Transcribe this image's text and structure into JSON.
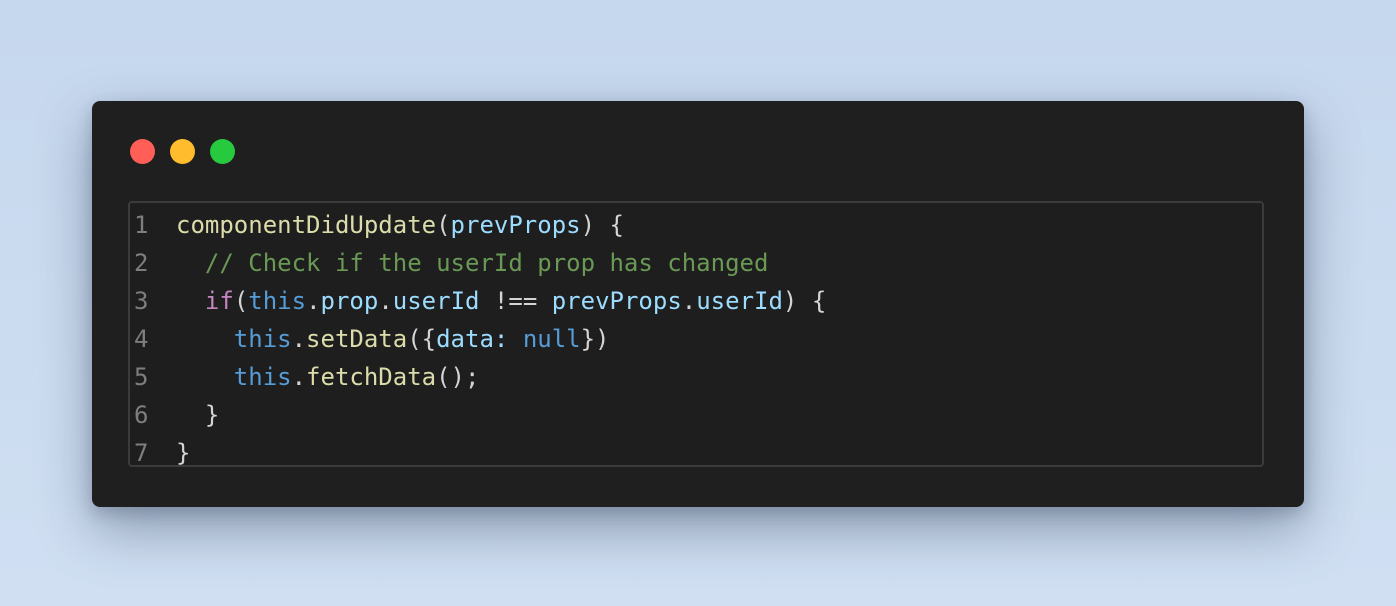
{
  "window": {
    "controls": [
      {
        "name": "close",
        "color": "#ff5f56"
      },
      {
        "name": "minimize",
        "color": "#ffbd2e"
      },
      {
        "name": "maximize",
        "color": "#27c93f"
      }
    ]
  },
  "colors": {
    "function": "#dcdcaa",
    "variable": "#9cdcfe",
    "keyword": "#569cd6",
    "control": "#c586c0",
    "comment": "#6a9955",
    "plain": "#d4d4d4"
  },
  "code": {
    "lines": [
      {
        "number": "1",
        "tokens": [
          {
            "text": "componentDidUpdate",
            "kind": "function"
          },
          {
            "text": "(",
            "kind": "plain"
          },
          {
            "text": "prevProps",
            "kind": "variable"
          },
          {
            "text": ") {",
            "kind": "plain"
          }
        ]
      },
      {
        "number": "2",
        "tokens": [
          {
            "text": "  ",
            "kind": "plain"
          },
          {
            "text": "// Check if the userId prop has changed",
            "kind": "comment"
          }
        ]
      },
      {
        "number": "3",
        "tokens": [
          {
            "text": "  ",
            "kind": "plain"
          },
          {
            "text": "if",
            "kind": "control"
          },
          {
            "text": "(",
            "kind": "plain"
          },
          {
            "text": "this",
            "kind": "keyword"
          },
          {
            "text": ".",
            "kind": "plain"
          },
          {
            "text": "prop",
            "kind": "variable"
          },
          {
            "text": ".",
            "kind": "plain"
          },
          {
            "text": "userId",
            "kind": "variable"
          },
          {
            "text": " !== ",
            "kind": "plain"
          },
          {
            "text": "prevProps",
            "kind": "variable"
          },
          {
            "text": ".",
            "kind": "plain"
          },
          {
            "text": "userId",
            "kind": "variable"
          },
          {
            "text": ") {",
            "kind": "plain"
          }
        ]
      },
      {
        "number": "4",
        "tokens": [
          {
            "text": "    ",
            "kind": "plain"
          },
          {
            "text": "this",
            "kind": "keyword"
          },
          {
            "text": ".",
            "kind": "plain"
          },
          {
            "text": "setData",
            "kind": "function"
          },
          {
            "text": "({",
            "kind": "plain"
          },
          {
            "text": "data",
            "kind": "variable"
          },
          {
            "text": ": ",
            "kind": "variable"
          },
          {
            "text": "null",
            "kind": "keyword"
          },
          {
            "text": "})",
            "kind": "plain"
          }
        ]
      },
      {
        "number": "5",
        "tokens": [
          {
            "text": "    ",
            "kind": "plain"
          },
          {
            "text": "this",
            "kind": "keyword"
          },
          {
            "text": ".",
            "kind": "plain"
          },
          {
            "text": "fetchData",
            "kind": "function"
          },
          {
            "text": "();",
            "kind": "plain"
          }
        ]
      },
      {
        "number": "6",
        "tokens": [
          {
            "text": "  }",
            "kind": "plain"
          }
        ]
      },
      {
        "number": "7",
        "tokens": [
          {
            "text": "}",
            "kind": "plain"
          }
        ]
      }
    ]
  }
}
